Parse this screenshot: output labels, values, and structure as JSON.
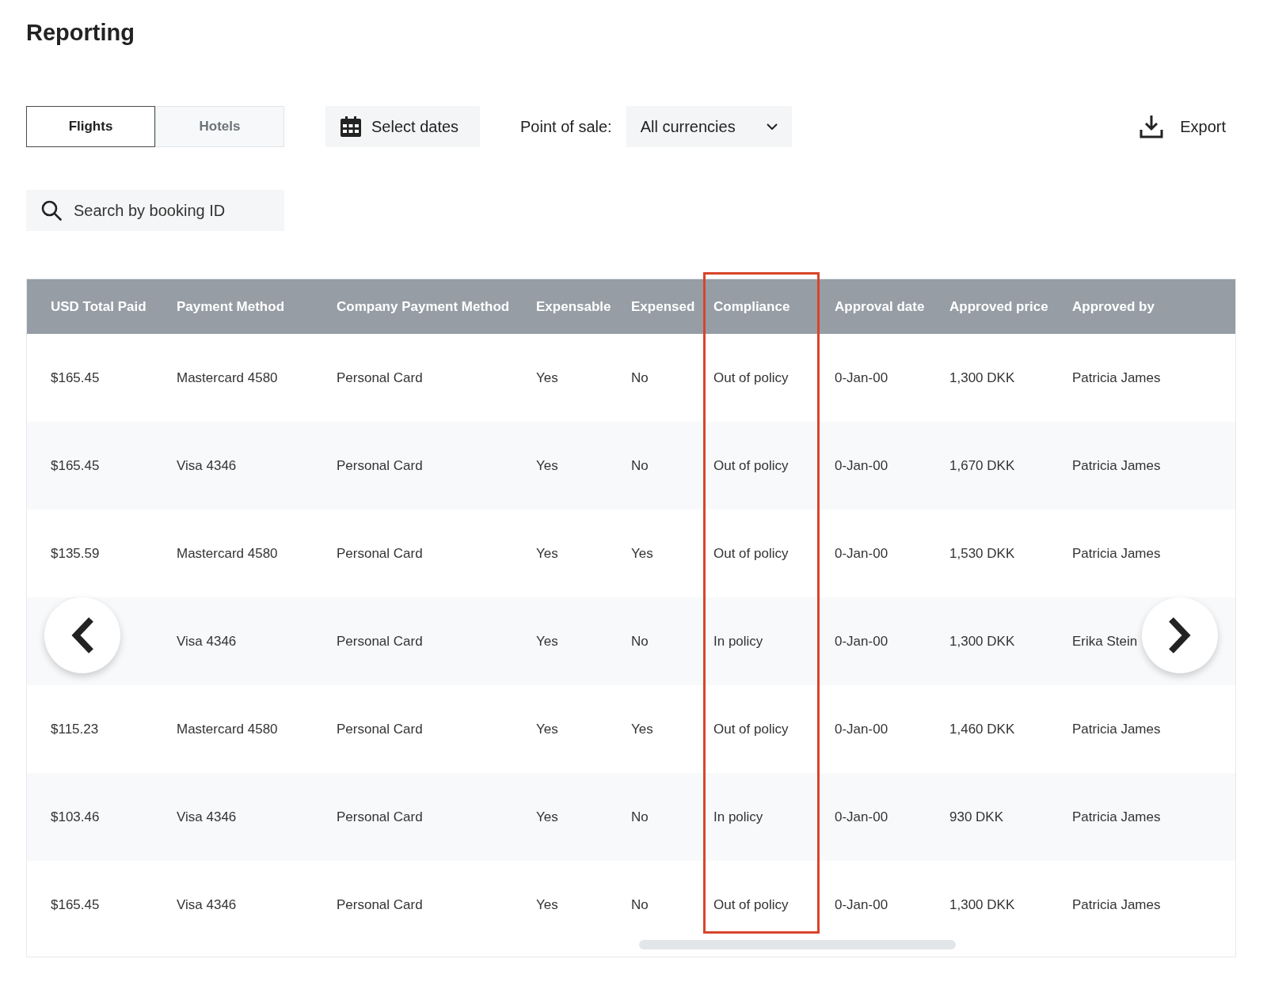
{
  "page_title": "Reporting",
  "tabs": [
    {
      "label": "Flights",
      "selected": true
    },
    {
      "label": "Hotels",
      "selected": false
    }
  ],
  "date_button": {
    "label": "Select dates"
  },
  "point_of_sale": {
    "label": "Point of sale:",
    "value": "All currencies"
  },
  "export_button": {
    "label": "Export"
  },
  "search": {
    "placeholder": "Search by booking ID"
  },
  "table": {
    "columns": [
      {
        "label": "USD Total Paid",
        "highlighted": false
      },
      {
        "label": "Payment Method",
        "highlighted": false
      },
      {
        "label": "Company Payment Method",
        "highlighted": false
      },
      {
        "label": "Expensable",
        "highlighted": false
      },
      {
        "label": "Expensed",
        "highlighted": false
      },
      {
        "label": "Compliance",
        "highlighted": true
      },
      {
        "label": "Approval date",
        "highlighted": false
      },
      {
        "label": "Approved price",
        "highlighted": false
      },
      {
        "label": "Approved by",
        "highlighted": false
      }
    ],
    "rows": [
      [
        "$165.45",
        "Mastercard 4580",
        "Personal Card",
        "Yes",
        "No",
        "Out of policy",
        "0-Jan-00",
        "1,300 DKK",
        "Patricia James"
      ],
      [
        "$165.45",
        "Visa 4346",
        "Personal Card",
        "Yes",
        "No",
        "Out of policy",
        "0-Jan-00",
        "1,670 DKK",
        "Patricia James"
      ],
      [
        "$135.59",
        "Mastercard 4580",
        "Personal Card",
        "Yes",
        "Yes",
        "Out of policy",
        "0-Jan-00",
        "1,530 DKK",
        "Patricia James"
      ],
      [
        null,
        "Visa 4346",
        "Personal Card",
        "Yes",
        "No",
        "In policy",
        "0-Jan-00",
        "1,300 DKK",
        "Erika Stein"
      ],
      [
        "$115.23",
        "Mastercard 4580",
        "Personal Card",
        "Yes",
        "Yes",
        "Out of policy",
        "0-Jan-00",
        "1,460 DKK",
        "Patricia James"
      ],
      [
        "$103.46",
        "Visa 4346",
        "Personal Card",
        "Yes",
        "No",
        "In policy",
        "0-Jan-00",
        "930 DKK",
        "Patricia James"
      ],
      [
        "$165.45",
        "Visa 4346",
        "Personal Card",
        "Yes",
        "No",
        "Out of policy",
        "0-Jan-00",
        "1,300 DKK",
        "Patricia James"
      ]
    ]
  }
}
